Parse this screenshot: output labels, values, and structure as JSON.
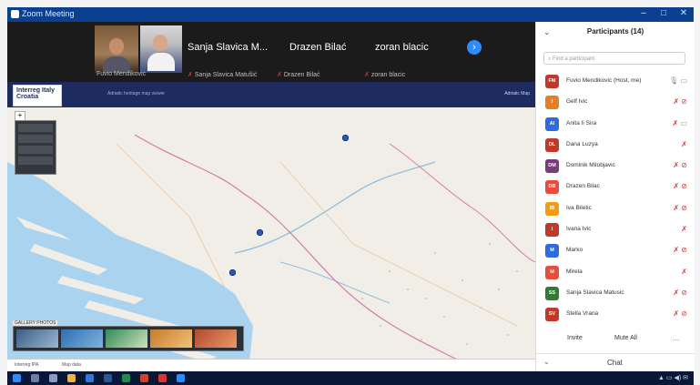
{
  "window": {
    "title": "Zoom Meeting",
    "controls": [
      "–",
      "□",
      "✕"
    ]
  },
  "video_strip": {
    "speakers_large": [
      {
        "name": "Sanja Slavica M..."
      },
      {
        "name": "Drazen Bilać"
      },
      {
        "name": "zoran blacic"
      }
    ],
    "thumb_labels": [
      {
        "name": "Fuvio Mendikovic"
      },
      {
        "name": "Sanja Slavica Matušić"
      },
      {
        "name": "Drazen Bilać"
      },
      {
        "name": "zoran blacic"
      }
    ],
    "next_icon": "chevron-right-icon"
  },
  "shared_screen": {
    "logo_text": "Interreg Italy Croatia",
    "header_caption": "Adriatic heritage map viewer",
    "header_right": "Adriatic Map",
    "gallery_title": "GALLERY PHOTOS",
    "footer_left": "Interreg IPA",
    "footer_mid": "Map data"
  },
  "participants": {
    "title": "Participants (14)",
    "search_placeholder": "Find a participant",
    "list": [
      {
        "initials": "FM",
        "name": "Fuvio Mendikovic (Host, me)",
        "color": "#c0392b",
        "icons": "mic-video"
      },
      {
        "initials": "I",
        "name": "Gelf Ivic",
        "color": "#e67e22",
        "icons": "muted-video-off"
      },
      {
        "initials": "AI",
        "name": "Anita Ii Sira",
        "color": "#2d6cdf",
        "icons": "muted-video"
      },
      {
        "initials": "DL",
        "name": "Dana Luzya",
        "color": "#c0392b",
        "icons": "muted"
      },
      {
        "initials": "DM",
        "name": "Dominik Milobjavic",
        "color": "#7b3a7b",
        "icons": "muted-video-off"
      },
      {
        "initials": "DB",
        "name": "Drazen Bilac",
        "color": "#e74c3c",
        "icons": "muted-video-off"
      },
      {
        "initials": "IB",
        "name": "Iva Biletic",
        "color": "#f39c12",
        "icons": "muted-video-off"
      },
      {
        "initials": "I",
        "name": "Ivana Ivic",
        "color": "#c0392b",
        "icons": "muted"
      },
      {
        "initials": "M",
        "name": "Marko",
        "color": "#2d6cdf",
        "icons": "muted-video-off"
      },
      {
        "initials": "M",
        "name": "Mirela",
        "color": "#e74c3c",
        "icons": "muted"
      },
      {
        "initials": "SS",
        "name": "Sanja Slavica Matusic",
        "color": "#2e7d32",
        "icons": "muted-video-off"
      },
      {
        "initials": "SV",
        "name": "Stella Vrana",
        "color": "#c0392b",
        "icons": "muted-video-off"
      }
    ],
    "actions": {
      "invite": "Invite",
      "mute_all": "Mute All",
      "more": "..."
    },
    "chat": "Chat"
  },
  "colors": {
    "zoom_blue": "#2d8cff",
    "muted_red": "#e0332b",
    "titlebar": "#0b3f8f",
    "taskbar": "#0a1838"
  }
}
